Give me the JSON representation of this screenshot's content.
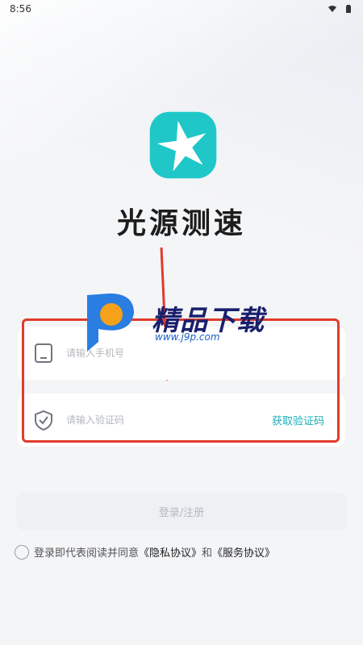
{
  "status_bar": {
    "time": "8:56",
    "icons": [
      "wifi-icon",
      "battery-icon"
    ]
  },
  "app": {
    "logo_icon": "star-logo-icon",
    "name": "光源测速",
    "accent_color": "#19b0b8"
  },
  "watermark": {
    "text": "精品下载",
    "url": "www.j9p.com"
  },
  "form": {
    "phone": {
      "icon": "phone-icon",
      "placeholder": "请输入手机号",
      "value": ""
    },
    "code": {
      "icon": "shield-check-icon",
      "placeholder": "请输入验证码",
      "value": "",
      "get_code_label": "获取验证码"
    }
  },
  "login_button_label": "登录/注册",
  "agreement": {
    "prefix": "登录即代表阅读并同意",
    "privacy_label": "《隐私协议》",
    "and": "和",
    "service_label": "《服务协议》"
  },
  "annotation": {
    "highlight_color": "#e13b2c"
  }
}
